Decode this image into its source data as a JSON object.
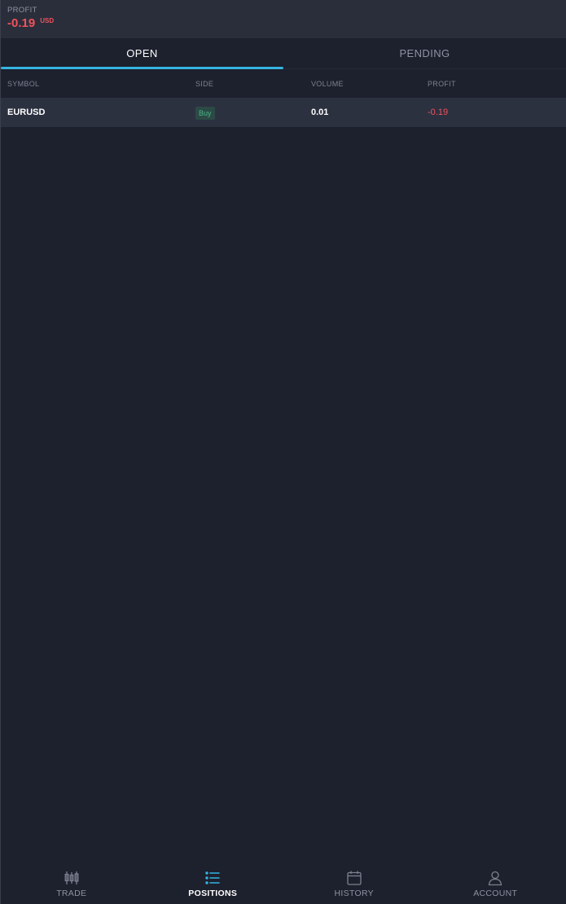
{
  "header": {
    "profit_label": "PROFIT",
    "profit_value": "-0.19",
    "profit_currency": "USD"
  },
  "tabs": [
    {
      "label": "OPEN",
      "active": true
    },
    {
      "label": "PENDING",
      "active": false
    }
  ],
  "table": {
    "columns": [
      "SYMBOL",
      "SIDE",
      "VOLUME",
      "PROFIT"
    ],
    "rows": [
      {
        "symbol": "EURUSD",
        "side": "Buy",
        "volume": "0.01",
        "profit": "-0.19"
      }
    ]
  },
  "bottom_nav": [
    {
      "label": "TRADE",
      "icon": "candlestick-icon",
      "active": false
    },
    {
      "label": "POSITIONS",
      "icon": "list-icon",
      "active": true
    },
    {
      "label": "HISTORY",
      "icon": "calendar-icon",
      "active": false
    },
    {
      "label": "ACCOUNT",
      "icon": "user-icon",
      "active": false
    }
  ],
  "colors": {
    "background": "#1d202d",
    "header": "#2a2e3b",
    "accent": "#35b4e1",
    "loss": "#f0525d",
    "buy": "#4ab58a"
  }
}
